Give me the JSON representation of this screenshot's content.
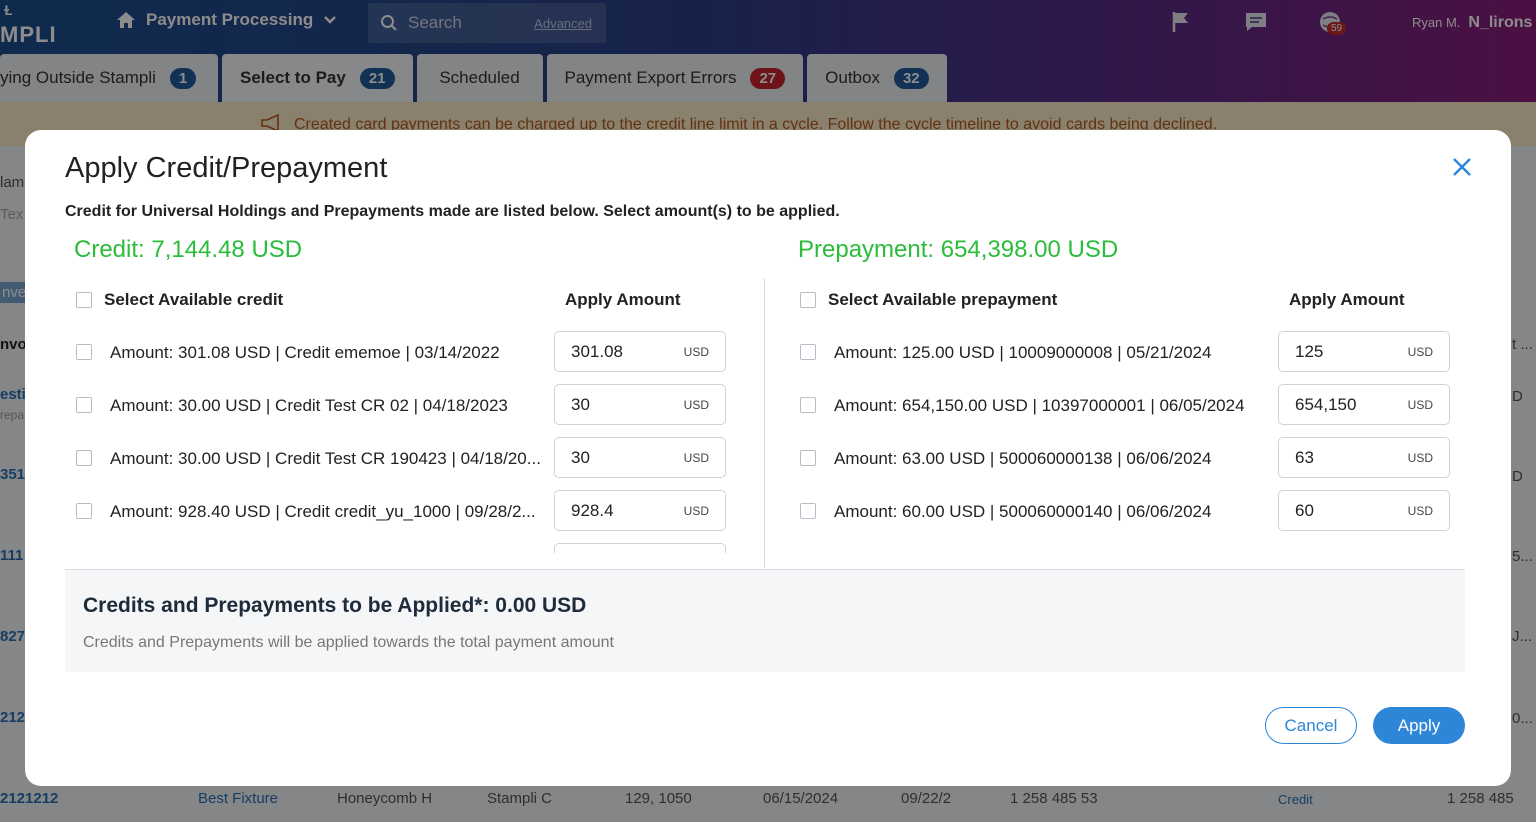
{
  "header": {
    "logo_text": "MPLI",
    "nav_title": "Payment Processing",
    "search_placeholder": "Search",
    "search_advanced": "Advanced",
    "notifications_count": "59",
    "user_name": "Ryan M.",
    "org_name": "N_lirons"
  },
  "tabs": [
    {
      "label": "ying Outside Stampli",
      "count": "1",
      "color": "blue"
    },
    {
      "label": "Select to Pay",
      "count": "21",
      "color": "blue"
    },
    {
      "label": "Scheduled",
      "count": ""
    },
    {
      "label": "Payment Export Errors",
      "count": "27",
      "color": "red"
    },
    {
      "label": "Outbox",
      "count": "32",
      "color": "blue"
    }
  ],
  "banner_text": "Created card payments can be charged up to the credit line limit in a cycle. Follow the cycle timeline to avoid cards being declined.",
  "background_table": {
    "col_labels": [
      "lam",
      "Tex",
      "nve",
      "nvo"
    ],
    "row_ids": [
      "esti",
      "351",
      "111",
      "827",
      "212",
      "2121212"
    ],
    "row_sub": "repa",
    "right_fragments": [
      "t ...",
      "D",
      "5...",
      "J...",
      "0...",
      "D"
    ],
    "bottom_row": [
      "Best Fixture",
      "Honeycomb H",
      "Stampli C",
      "129, 1050",
      "06/15/2024",
      "09/22/2",
      "1 258 485 53",
      "Credit",
      "1 258 485"
    ]
  },
  "modal": {
    "title": "Apply Credit/Prepayment",
    "subtitle": "Credit for Universal Holdings and Prepayments made are listed below. Select amount(s) to be applied.",
    "credit": {
      "title": "Credit: 7,144.48 USD",
      "select_all_label": "Select Available credit",
      "apply_header": "Apply Amount",
      "rows": [
        {
          "label": "Amount:  301.08 USD | Credit ememoe | 03/14/2022",
          "value": "301.08",
          "currency": "USD"
        },
        {
          "label": "Amount:  30.00 USD | Credit Test CR 02 | 04/18/2023",
          "value": "30",
          "currency": "USD"
        },
        {
          "label": "Amount:  30.00 USD | Credit Test CR 190423 | 04/18/20...",
          "value": "30",
          "currency": "USD"
        },
        {
          "label": "Amount:  928.40 USD | Credit credit_yu_1000 | 09/28/2...",
          "value": "928.4",
          "currency": "USD"
        }
      ]
    },
    "prepayment": {
      "title": "Prepayment: 654,398.00 USD",
      "select_all_label": "Select Available prepayment",
      "apply_header": "Apply Amount",
      "rows": [
        {
          "label": "Amount:  125.00 USD | 10009000008 | 05/21/2024",
          "value": "125",
          "currency": "USD"
        },
        {
          "label": "Amount:  654,150.00 USD | 10397000001 | 06/05/2024",
          "value": "654,150",
          "currency": "USD"
        },
        {
          "label": "Amount:  63.00 USD | 500060000138 | 06/06/2024",
          "value": "63",
          "currency": "USD"
        },
        {
          "label": "Amount:  60.00 USD | 500060000140 | 06/06/2024",
          "value": "60",
          "currency": "USD"
        }
      ]
    },
    "summary_total": "Credits and Prepayments to be Applied*:  0.00 USD",
    "summary_note": "Credits and Prepayments will be applied towards the total payment amount",
    "cancel_label": "Cancel",
    "apply_label": "Apply"
  }
}
